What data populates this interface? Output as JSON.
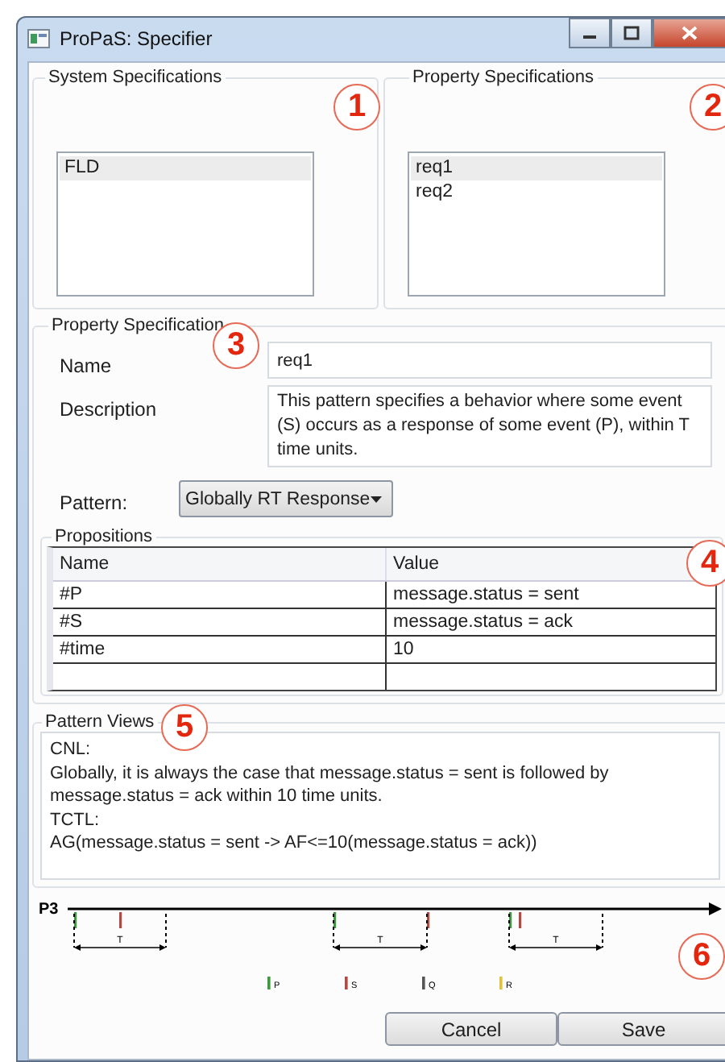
{
  "window": {
    "title": "ProPaS: Specifier"
  },
  "system_specifications": {
    "title": "System Specifications",
    "items": [
      {
        "label": "FLD",
        "selected": true
      }
    ]
  },
  "property_specifications": {
    "title": "Property Specifications",
    "items": [
      {
        "label": "req1",
        "selected": true
      },
      {
        "label": "req2",
        "selected": false
      }
    ]
  },
  "property_specification": {
    "title": "Property Specification",
    "name_label": "Name",
    "name_value": "req1",
    "description_label": "Description",
    "description_value": "This pattern specifies a behavior where some event (S) occurs as a response of some event (P), within T time units.",
    "pattern_label": "Pattern:",
    "pattern_value": "Globally RT Response"
  },
  "propositions": {
    "title": "Propositions",
    "columns": [
      "Name",
      "Value"
    ],
    "rows": [
      [
        "#P",
        "message.status = sent"
      ],
      [
        "#S",
        "message.status = ack"
      ],
      [
        "#time",
        "10"
      ]
    ]
  },
  "pattern_views": {
    "title": "Pattern Views",
    "lines": [
      "CNL:",
      " Globally, it is always the case that message.status = sent is followed by message.status = ack within 10 time units.",
      "TCTL:",
      " AG(message.status = sent -> AF<=10(message.status = ack))"
    ]
  },
  "timeline": {
    "label": "P3",
    "windows": [
      {
        "label": "T",
        "events": [
          {
            "color": "#3c9a3c"
          },
          {
            "color": "#b04a44"
          }
        ]
      },
      {
        "label": "T",
        "events": [
          {
            "color": "#3c9a3c"
          },
          {
            "color": "#b04a44"
          }
        ]
      },
      {
        "label": "T",
        "events": [
          {
            "color": "#3c9a3c"
          },
          {
            "color": "#b04a44"
          }
        ]
      }
    ],
    "legend": [
      {
        "label": "P",
        "color": "#3c9a3c"
      },
      {
        "label": "S",
        "color": "#b04a44"
      },
      {
        "label": "Q",
        "color": "#555555"
      },
      {
        "label": "R",
        "color": "#e0c23a"
      }
    ]
  },
  "buttons": [
    "Cancel",
    "Save"
  ],
  "annotations": [
    "1",
    "2",
    "3",
    "4",
    "5",
    "6"
  ]
}
